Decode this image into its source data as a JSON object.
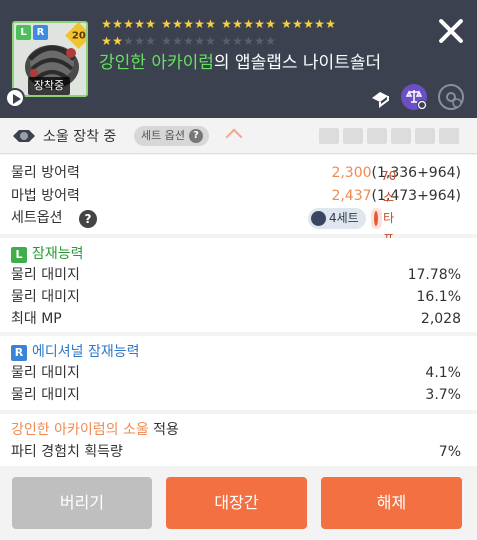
{
  "header": {
    "badges": {
      "left": "L",
      "right": "R",
      "level": "20"
    },
    "equipped_tag": "장착중",
    "stars": {
      "filled": 22,
      "total": 35,
      "group_size": 5,
      "groups_per_row": 4
    },
    "item_name": {
      "soul": "강인한 아카이럼",
      "rest": "의 앱솔랩스 나이트숄더"
    },
    "icons": [
      "share-icon",
      "compare-icon",
      "settings-icon",
      "close-icon",
      "play-icon"
    ]
  },
  "soul_bar": {
    "label": "소울 장착 중",
    "set_option_label": "세트 옵션",
    "help": "?"
  },
  "stats": {
    "phys_def": {
      "label": "물리 방어력",
      "total": "2,300",
      "breakdown": "(1,336+964)"
    },
    "mag_def": {
      "label": "마법 방어력",
      "total": "2,437",
      "breakdown": "(1,473+964)"
    },
    "set_option": {
      "label": "세트옵션",
      "help": "?",
      "set_pill": "4세트",
      "star_pill": "70스타포스"
    }
  },
  "potential": {
    "title": "잠재능력",
    "badge": "L",
    "rows": [
      {
        "label": "물리 대미지",
        "value": "17.78%"
      },
      {
        "label": "물리 대미지",
        "value": "16.1%"
      },
      {
        "label": "최대 MP",
        "value": "2,028"
      }
    ]
  },
  "additional": {
    "title": "에디셔널 잠재능력",
    "badge": "R",
    "rows": [
      {
        "label": "물리 대미지",
        "value": "4.1%"
      },
      {
        "label": "물리 대미지",
        "value": "3.7%"
      }
    ]
  },
  "soul_effect": {
    "name": "강인한 아카이럼의 소울",
    "suffix": " 적용",
    "label": "파티 경험치 획득량",
    "value": "7%"
  },
  "buttons": {
    "discard": "버리기",
    "forge": "대장간",
    "unequip": "해제"
  },
  "colors": {
    "header_bg": "#3c4150",
    "accent": "#f08a50",
    "soul_green": "#67e05f",
    "primary_button": "#f27042",
    "disabled_button": "#bfbfbf"
  }
}
